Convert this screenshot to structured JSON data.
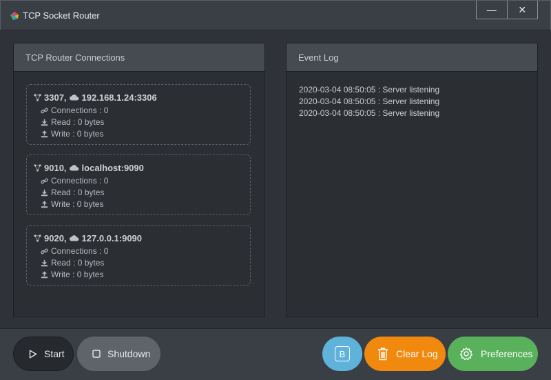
{
  "window": {
    "title": "TCP Socket Router",
    "minimize_glyph": "—",
    "close_glyph": "✕"
  },
  "connections_panel": {
    "title": "TCP Router Connections",
    "items": [
      {
        "port": "3307,",
        "target": "192.168.1.24:3306",
        "connections": "Connections : 0",
        "read": "Read : 0 bytes",
        "write": "Write : 0 bytes"
      },
      {
        "port": "9010,",
        "target": "localhost:9090",
        "connections": "Connections : 0",
        "read": "Read : 0 bytes",
        "write": "Write : 0 bytes"
      },
      {
        "port": "9020,",
        "target": "127.0.0.1:9090",
        "connections": "Connections : 0",
        "read": "Read : 0 bytes",
        "write": "Write : 0 bytes"
      }
    ]
  },
  "event_log": {
    "title": "Event Log",
    "lines": [
      "2020-03-04 08:50:05 : Server listening",
      "2020-03-04 08:50:05 : Server listening",
      "2020-03-04 08:50:05 : Server listening"
    ]
  },
  "toolbar": {
    "start_label": "Start",
    "shutdown_label": "Shutdown",
    "b_label": "B",
    "clear_log_label": "Clear Log",
    "preferences_label": "Preferences"
  },
  "colors": {
    "accent_blue": "#5fb2d9",
    "accent_orange": "#f2890f",
    "accent_green": "#59b15b"
  }
}
